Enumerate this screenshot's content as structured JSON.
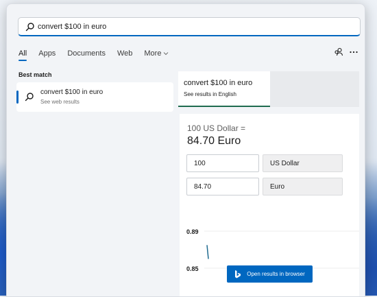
{
  "search": {
    "query": "convert $100 in euro"
  },
  "tabs": [
    {
      "label": "All",
      "active": true
    },
    {
      "label": "Apps"
    },
    {
      "label": "Documents"
    },
    {
      "label": "Web"
    },
    {
      "label": "More"
    }
  ],
  "best_match": {
    "heading": "Best match",
    "title": "convert $100 in euro",
    "subtitle": "See web results"
  },
  "preview": {
    "tab_title": "convert $100 in euro",
    "tab_subtitle": "See results in English",
    "rate_line": "100 US Dollar =",
    "rate_value": "84.70 Euro",
    "amount_from": "100",
    "currency_from": "US Dollar",
    "amount_to": "84.70",
    "currency_to": "Euro",
    "open_button": "Open results in browser"
  },
  "chart_data": {
    "type": "line",
    "yticks": [
      "0.89",
      "0.85"
    ],
    "ylim": [
      0.85,
      0.89
    ],
    "series": [
      {
        "values": [
          0.875,
          0.86
        ]
      }
    ]
  },
  "colors": {
    "accent": "#0067c0",
    "tab_underline": "#1f6b4f"
  },
  "icons": [
    "search-icon",
    "chevron-down-icon",
    "accounts-icon",
    "more-options-icon",
    "bing-icon"
  ]
}
